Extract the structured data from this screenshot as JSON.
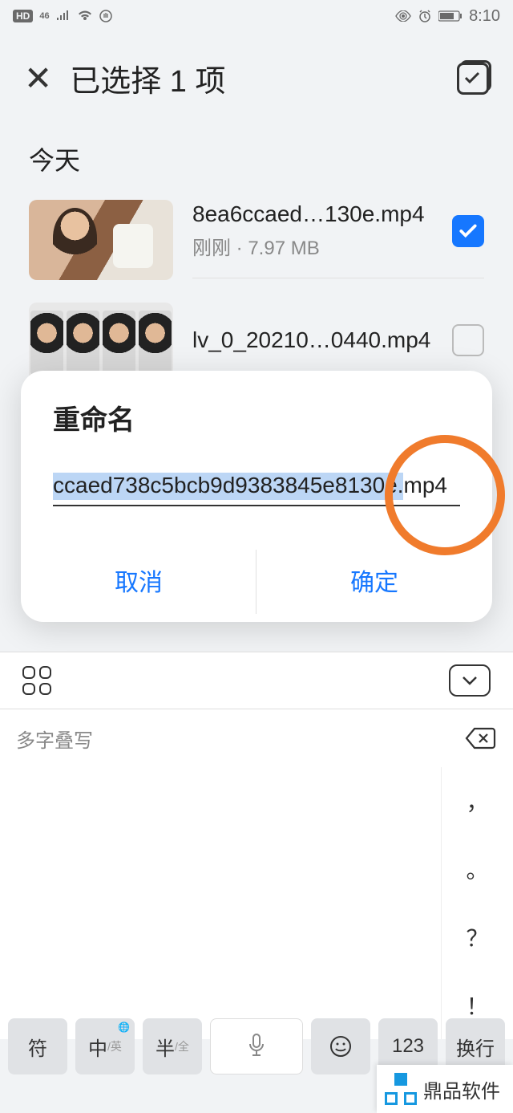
{
  "status": {
    "time": "8:10",
    "hd": "HD",
    "net": "46"
  },
  "header": {
    "title": "已选择 1 项"
  },
  "section": {
    "today": "今天"
  },
  "files": [
    {
      "name": "8ea6ccaed…130e.mp4",
      "meta": "刚刚 · 7.97 MB",
      "checked": true
    },
    {
      "name": "lv_0_20210…0440.mp4",
      "meta": "",
      "checked": false
    }
  ],
  "modal": {
    "title": "重命名",
    "value": "ccaed738c5bcb9d9383845e8130e.mp4",
    "cancel": "取消",
    "confirm": "确定"
  },
  "keyboard": {
    "candidate": "多字叠写",
    "puncts": [
      "，",
      "。",
      "？",
      "！"
    ],
    "keys": {
      "symbol": "符",
      "zh": "中",
      "zh_sub": "/英",
      "half": "半",
      "half_sub": "/全",
      "num": "123",
      "enter": "换行"
    }
  },
  "watermark": "鼎品软件"
}
